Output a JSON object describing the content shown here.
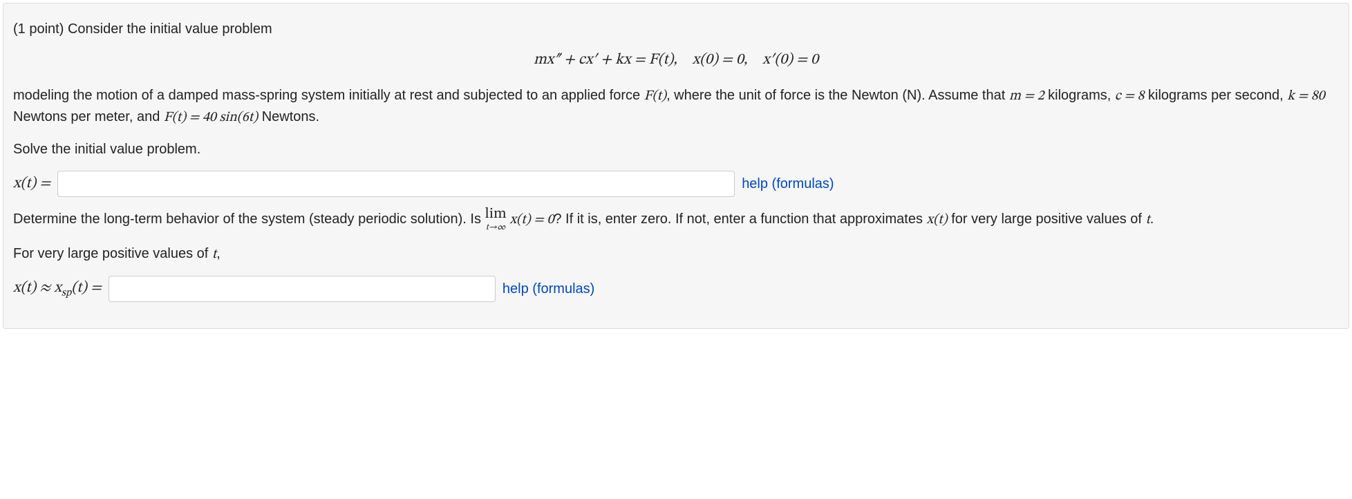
{
  "points_prefix": "(1 point) ",
  "intro_text": "Consider the initial value problem",
  "equation_display": "mx″ + cx′ + kx = F(t), x(0) = 0, x′(0) = 0",
  "para2_a": "modeling the motion of a damped mass-spring system initially at rest and subjected to an applied force ",
  "para2_ft": "F(t)",
  "para2_b": ", where the unit of force is the Newton (N). Assume that ",
  "m_eq": "m = 2",
  "m_unit": " kilograms, ",
  "c_eq": "c = 8",
  "c_unit": " kilograms per second, ",
  "k_eq": "k = 80",
  "k_unit": " Newtons per meter, and ",
  "F_eq": "F(t) = 40 sin(6t)",
  "F_unit": " Newtons.",
  "solve_text": "Solve the initial value problem.",
  "answer1_label": "x(t) = ",
  "answer1_value": "",
  "help_label": "help (formulas)",
  "longterm_a": "Determine the long-term behavior of the system (steady periodic solution). Is ",
  "lim_top": "lim",
  "lim_bot": "t→∞",
  "lim_expr": " x(t) = 0",
  "longterm_b": "? If it is, enter zero. If not, enter a function that approximates ",
  "longterm_c": "x(t)",
  "longterm_d": " for very large positive values of ",
  "longterm_e": "t",
  "longterm_f": ".",
  "large_t_text_a": "For very large positive values of ",
  "large_t_text_b": "t",
  "large_t_text_c": ",",
  "answer2_label_a": "x(t) ≈ x",
  "answer2_label_sub": "sp",
  "answer2_label_b": "(t) = ",
  "answer2_value": ""
}
